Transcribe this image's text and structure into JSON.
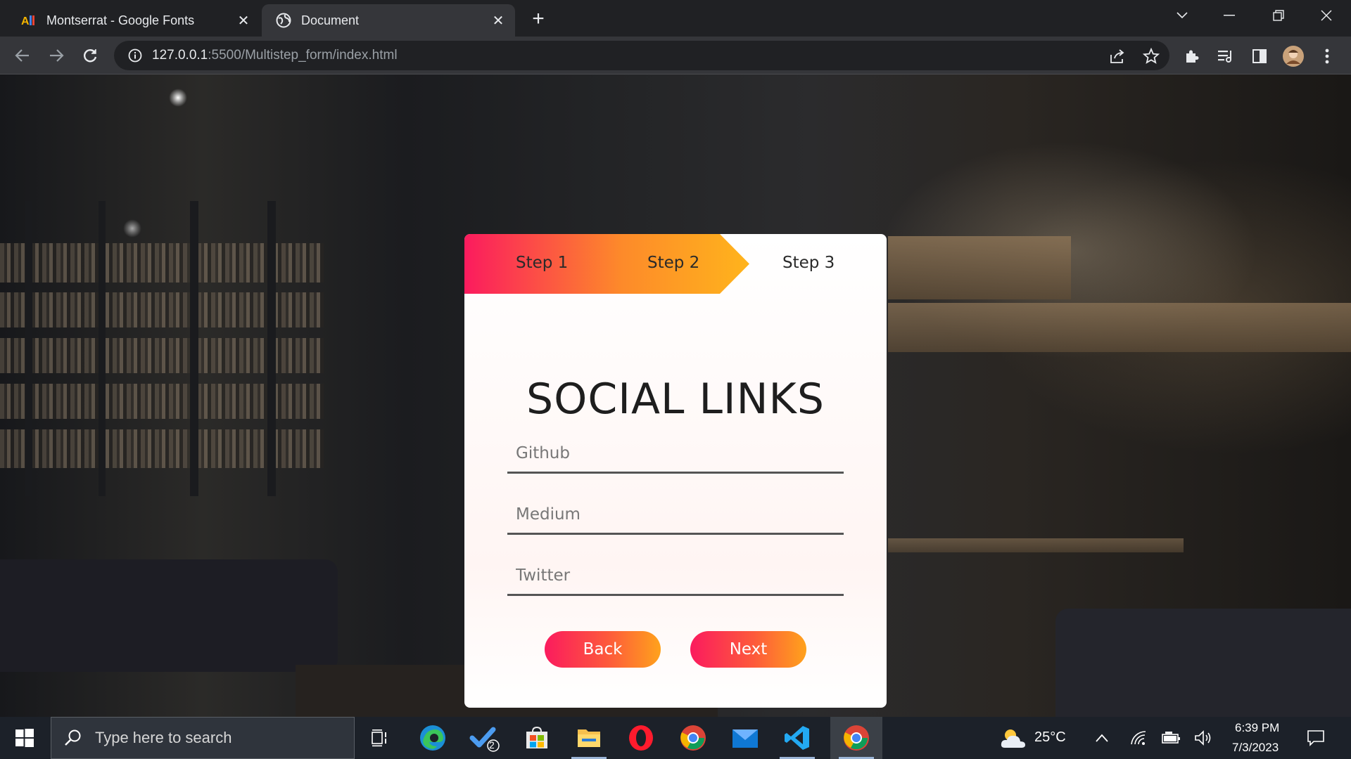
{
  "browser": {
    "tabs": [
      {
        "title": "Montserrat - Google Fonts",
        "favicon": "google-fonts-icon",
        "active": false
      },
      {
        "title": "Document",
        "favicon": "globe-icon",
        "active": true
      }
    ],
    "url_host": "127.0.0.1",
    "url_path": ":5500/Multistep_form/index.html"
  },
  "form": {
    "steps": [
      "Step 1",
      "Step 2",
      "Step 3"
    ],
    "current_step": 3,
    "heading": "SOCIAL LINKS",
    "fields": [
      {
        "placeholder": "Github",
        "value": ""
      },
      {
        "placeholder": "Medium",
        "value": ""
      },
      {
        "placeholder": "Twitter",
        "value": ""
      }
    ],
    "back_label": "Back",
    "next_label": "Next",
    "gradient_colors": [
      "#fb1b5e",
      "#ffa21c"
    ]
  },
  "taskbar": {
    "search_placeholder": "Type here to search",
    "todo_badge": "2",
    "weather": "25°C",
    "time": "6:39 PM",
    "date": "7/3/2023"
  }
}
